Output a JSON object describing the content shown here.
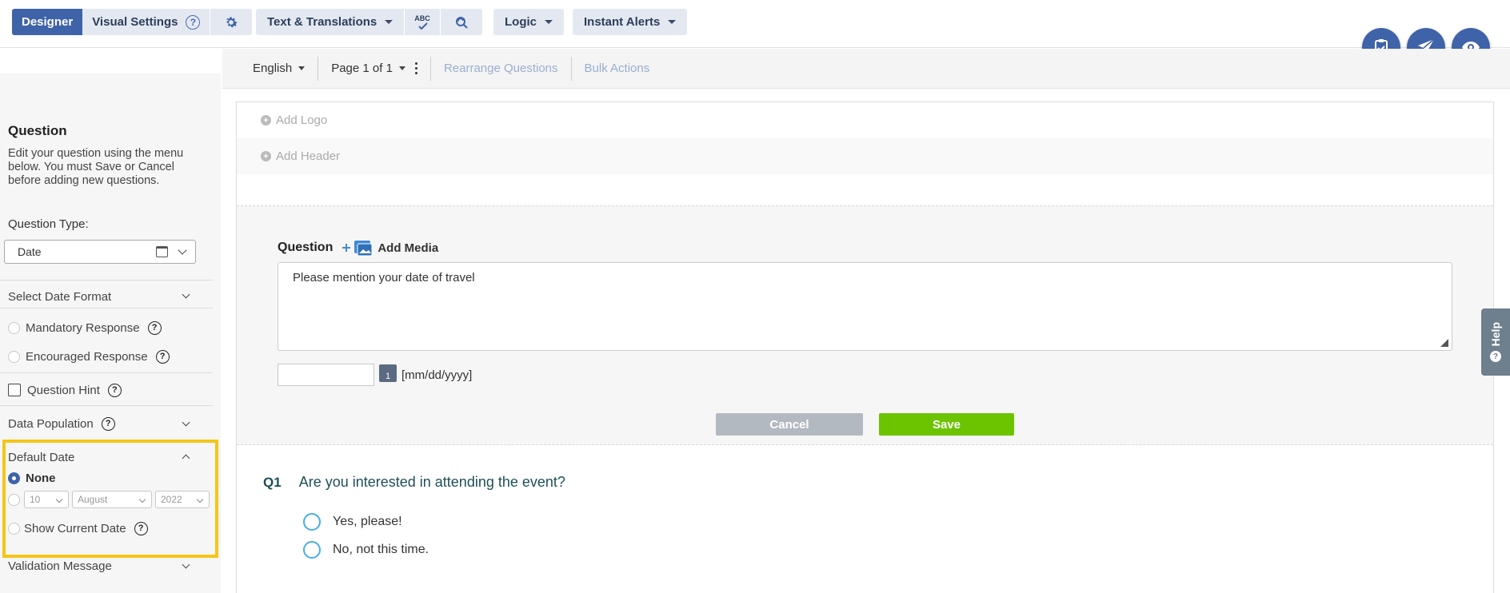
{
  "toolbar": {
    "designer": "Designer",
    "visual_settings": "Visual Settings",
    "text_translations": "Text & Translations",
    "spell_label": "ABC",
    "logic": "Logic",
    "instant_alerts": "Instant Alerts"
  },
  "subbar": {
    "language": "English",
    "page": "Page 1 of 1",
    "rearrange": "Rearrange Questions",
    "bulk_actions": "Bulk Actions"
  },
  "left": {
    "title": "Question",
    "description": "Edit your question using the menu below. You must Save or Cancel before adding new questions.",
    "question_type_label": "Question Type:",
    "question_type_value": "Date",
    "select_date_format": "Select Date Format",
    "mandatory": "Mandatory Response",
    "encouraged": "Encouraged Response",
    "question_hint": "Question Hint",
    "data_population": "Data Population",
    "default_date": "Default Date",
    "none": "None",
    "day": "10",
    "month": "August",
    "year": "2022",
    "show_current_date": "Show Current Date",
    "validation_message": "Validation Message"
  },
  "main": {
    "add_logo": "Add Logo",
    "add_header": "Add Header",
    "question_label": "Question",
    "add_media": "Add Media",
    "question_text": "Please mention your date of travel",
    "cal_day": "1",
    "date_format": "[mm/dd/yyyy]",
    "cancel": "Cancel",
    "save": "Save",
    "q1_num": "Q1",
    "q1_text": "Are you interested in attending the event?",
    "choices": [
      "Yes, please!",
      "No, not this time."
    ]
  },
  "help_tab": "Help",
  "colors": {
    "primary": "#3f63a8",
    "save": "#6cc400",
    "highlight": "#f5c518"
  }
}
